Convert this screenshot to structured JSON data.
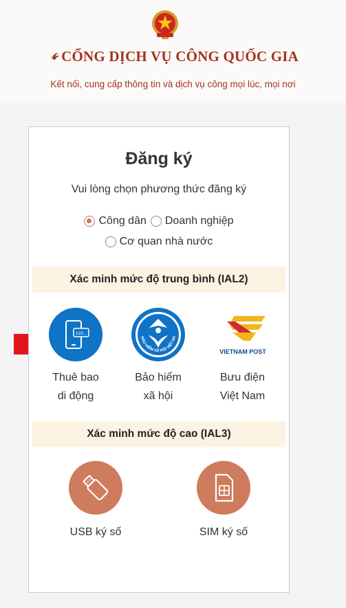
{
  "header": {
    "title": "CỔNG DỊCH VỤ CÔNG QUỐC GIA",
    "tagline": "Kết nối, cung cấp thông tin và dịch vụ công mọi lúc, mọi nơi"
  },
  "card": {
    "title": "Đăng ký",
    "subtitle": "Vui lòng chọn phương thức đăng ký",
    "radios": [
      {
        "label": "Công dân",
        "checked": true
      },
      {
        "label": "Doanh nghiệp",
        "checked": false
      },
      {
        "label": "Cơ quan nhà nước",
        "checked": false
      }
    ],
    "section_medium": "Xác minh mức độ trung bình (IAL2)",
    "section_high": "Xác minh mức độ cao (IAL3)",
    "options_medium": [
      {
        "line1": "Thuê bao",
        "line2": "di động",
        "icon": "mobile-phone-icon",
        "badge": "123..."
      },
      {
        "line1": "Bảo hiểm",
        "line2": "xã hội",
        "icon": "social-insurance-logo",
        "logo_text": "BẢO HIỂM XÃ HỘI VIỆT NAM"
      },
      {
        "line1": "Bưu điện",
        "line2": "Việt Nam",
        "icon": "vietnam-post-logo",
        "logo_text": "VIETNAM POST"
      }
    ],
    "options_high": [
      {
        "label": "USB ký số",
        "icon": "usb-token-icon"
      },
      {
        "label": "SIM ký số",
        "icon": "sim-card-icon"
      }
    ]
  },
  "colors": {
    "brand_red": "#a5321f",
    "accent_orange": "#cf7b5d",
    "blue": "#0f73c7",
    "band_bg": "#fcf3e3",
    "arrow_red": "#e3151b",
    "vnpost_yellow": "#f4b41a"
  }
}
